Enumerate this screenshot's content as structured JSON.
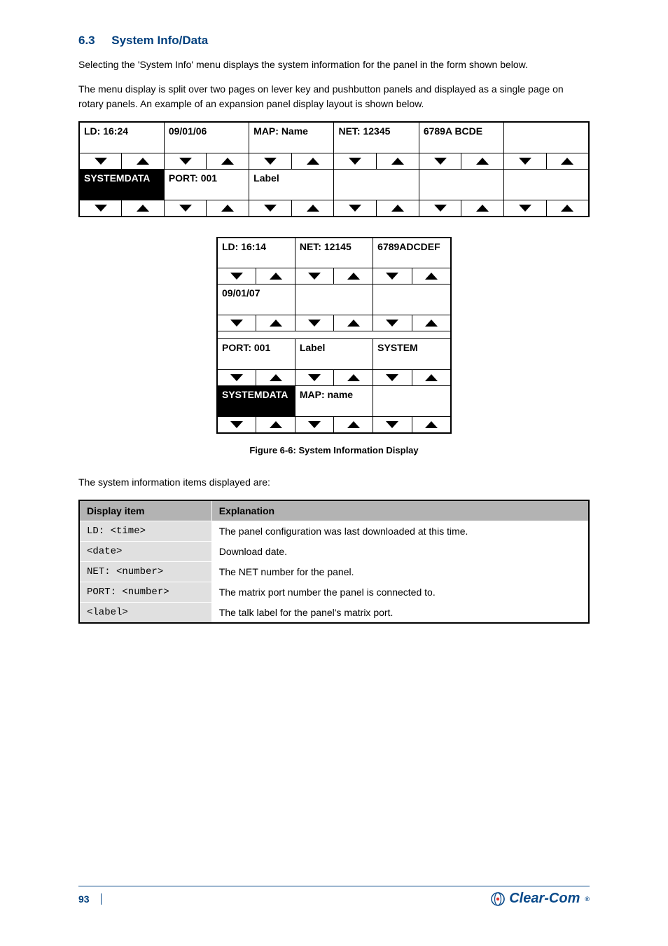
{
  "section": {
    "number": "6.3",
    "title": "System Info/Data"
  },
  "intro_paragraphs": [
    "Selecting the 'System Info' menu displays the system information for the panel in the form shown below.",
    "The menu display is split over two pages on lever key and pushbutton panels and displayed as a single page on rotary panels. An example of an expansion panel display layout is shown below."
  ],
  "panel_wide": {
    "cols": 6,
    "rows": [
      [
        {
          "text": "LD: 16:24",
          "inv": false
        },
        {
          "text": "09/01/06",
          "inv": false
        },
        {
          "text": "MAP: Name",
          "inv": false
        },
        {
          "text": "NET:  12345",
          "inv": false
        },
        {
          "text": "6789A BCDE",
          "inv": false
        },
        {
          "text": "",
          "inv": false
        }
      ],
      [
        {
          "text": "SYSTEMDATA",
          "inv": true
        },
        {
          "text": "PORT:  001",
          "inv": false
        },
        {
          "text": "Label",
          "inv": false
        },
        {
          "text": "",
          "inv": false
        },
        {
          "text": "",
          "inv": false
        },
        {
          "text": "",
          "inv": false
        }
      ]
    ]
  },
  "panel_narrow": {
    "cols": 3,
    "rows": [
      [
        {
          "text": "LD: 16:14",
          "inv": false
        },
        {
          "text": "NET: 12145",
          "inv": false
        },
        {
          "text": "6789ADCDEF",
          "inv": false
        }
      ],
      [
        {
          "text": "09/01/07",
          "inv": false
        },
        {
          "text": "",
          "inv": false
        },
        {
          "text": "",
          "inv": false
        }
      ],
      [
        {
          "text": "PORT: 001",
          "inv": false
        },
        {
          "text": "Label",
          "inv": false
        },
        {
          "text": "SYSTEM",
          "inv": false
        }
      ],
      [
        {
          "text": "SYSTEMDATA",
          "inv": true
        },
        {
          "text": "MAP: name",
          "inv": false
        },
        {
          "text": "",
          "inv": false
        }
      ]
    ]
  },
  "figure_caption": {
    "number": "Figure 6-6:",
    "text": "System Information Display"
  },
  "post_text_1": "The system information items displayed are:",
  "info_table": {
    "headers": [
      "Display item",
      "Explanation"
    ],
    "rows": [
      [
        "LD: <time>",
        "The panel configuration was last downloaded at this time."
      ],
      [
        "<date>",
        "Download date."
      ],
      [
        "NET: <number>",
        "The NET number for the panel."
      ],
      [
        "PORT: <number>",
        "The matrix port number the panel is connected to."
      ],
      [
        "<label>",
        "The talk label for the panel's matrix port."
      ]
    ]
  },
  "footer": {
    "page": "93",
    "brand": "Clear-Com",
    "reg": "®"
  }
}
